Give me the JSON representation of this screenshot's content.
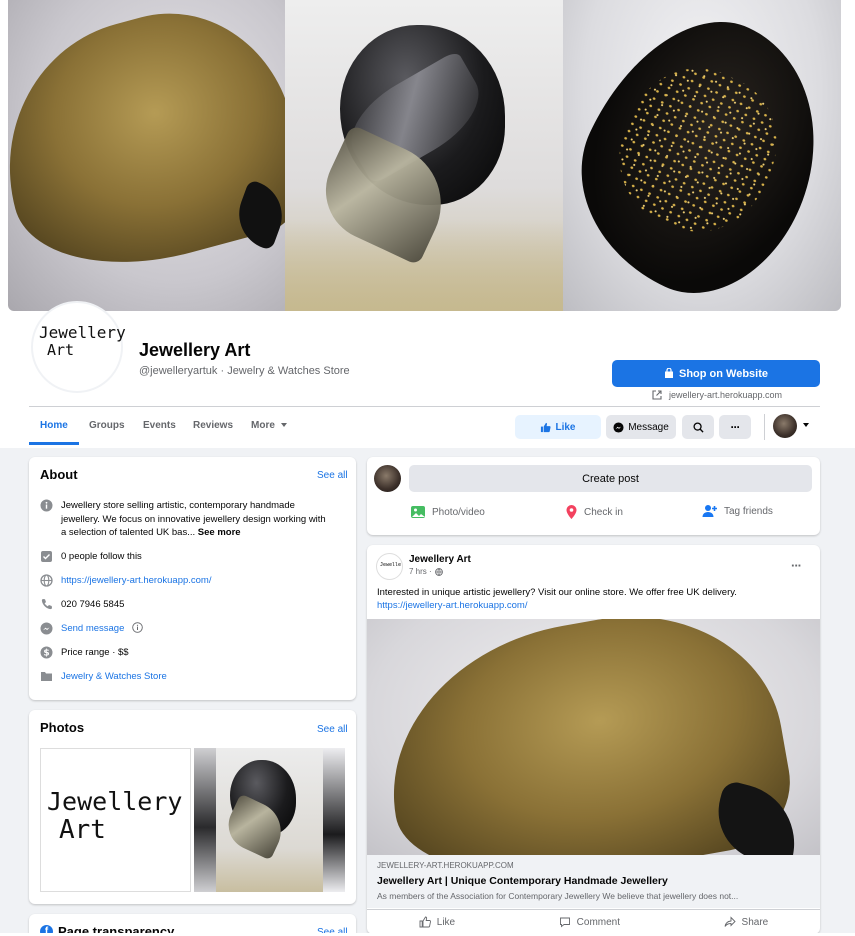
{
  "page": {
    "name": "Jewellery Art",
    "handle": "@jewelleryartuk · Jewelry & Watches Store",
    "logo_line1": "Jewellery",
    "logo_line2": "Art"
  },
  "header": {
    "shop_button": "Shop on Website",
    "shop_link": "jewellery-art.herokuapp.com"
  },
  "nav": {
    "tabs": [
      {
        "label": "Home",
        "active": true
      },
      {
        "label": "Groups"
      },
      {
        "label": "Events"
      },
      {
        "label": "Reviews"
      },
      {
        "label": "More"
      }
    ],
    "like": "Like",
    "message": "Message"
  },
  "about": {
    "title": "About",
    "see_all": "See all",
    "description": "Jewellery store selling artistic, contemporary handmade jewellery. We focus on innovative jewellery design working with a selection of talented UK bas...",
    "see_more": "See more",
    "followers": "0 people follow this",
    "website": "https://jewellery-art.herokuapp.com/",
    "phone": "020 7946 5845",
    "send_message": "Send message",
    "price_range": "Price range · $$",
    "category": "Jewelry & Watches Store"
  },
  "photos": {
    "title": "Photos",
    "see_all": "See all"
  },
  "transparency": {
    "title": "Page transparency",
    "see_all": "See all"
  },
  "composer": {
    "create_post": "Create post",
    "photo_video": "Photo/video",
    "check_in": "Check in",
    "tag_friends": "Tag friends"
  },
  "post": {
    "author": "Jewellery Art",
    "time": "7 hrs ·",
    "text": "Interested in unique artistic jewellery? Visit our online store. We offer free UK delivery.",
    "link": "https://jewellery-art.herokuapp.com/",
    "preview_domain": "JEWELLERY-ART.HEROKUAPP.COM",
    "preview_title": "Jewellery Art | Unique Contemporary Handmade Jewellery",
    "preview_desc": "As members of the Association for Contemporary Jewellery We believe that jewellery does not...",
    "actions": {
      "like": "Like",
      "comment": "Comment",
      "share": "Share"
    }
  },
  "colors": {
    "accent": "#1b74e4",
    "background": "#f0f2f5",
    "secondary_text": "#65676b"
  }
}
